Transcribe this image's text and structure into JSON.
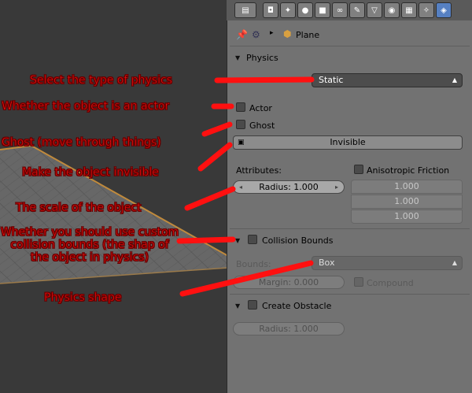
{
  "colors": {
    "annotation": "#ff1010",
    "active_tab": "#5680c2",
    "panel": "#727272",
    "plane_edge": "#c08a3c"
  },
  "tabs": [
    "render-icon",
    "scene-icon",
    "world-icon",
    "object-icon",
    "constraint-icon",
    "modifier-icon",
    "data-icon",
    "material-icon",
    "texture-icon",
    "particles-icon",
    "physics-icon"
  ],
  "breadcrumb": {
    "object_name": "Plane"
  },
  "physics": {
    "title": "Physics",
    "type_value": "Static",
    "actor_label": "Actor",
    "ghost_label": "Ghost",
    "invisible_label": "Invisible",
    "attributes_label": "Attributes:",
    "radius_value": "Radius: 1.000",
    "aniso_label": "Anisotropic Friction",
    "aniso_values": [
      "1.000",
      "1.000",
      "1.000"
    ]
  },
  "collision": {
    "title": "Collision Bounds",
    "bounds_label": "Bounds:",
    "bounds_value": "Box",
    "margin_value": "Margin: 0.000",
    "compound_label": "Compound"
  },
  "obstacle": {
    "title": "Create Obstacle",
    "radius_value": "Radius: 1.000"
  },
  "annotations": {
    "type": "Select the type of physics",
    "actor": "Whether the object is an actor",
    "ghost": "Ghost (move through things)",
    "invisible": "Make the object invisible",
    "scale": "The scale of the object",
    "bounds": "Whether you should use custom collision bounds (the shap of the object in physics)",
    "shape": "Physics shape"
  }
}
